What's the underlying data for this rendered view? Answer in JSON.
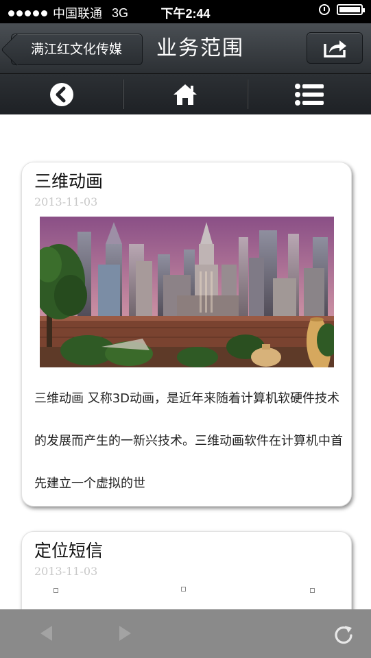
{
  "status_bar": {
    "carrier": "中国联通",
    "network": "3G",
    "time": "下午2:44"
  },
  "header": {
    "back_label": "满江红文化传媒",
    "title": "业务范围"
  },
  "toolbar": {
    "items": [
      "back",
      "home",
      "menu"
    ]
  },
  "articles": [
    {
      "title": "三维动画",
      "date": "2013-11-03",
      "text": "三维动画 又称3D动画，是近年来随着计算机软硬件技术的发展而产生的一新兴技术。三维动画软件在计算机中首先建立一个虚拟的世"
    },
    {
      "title": "定位短信",
      "date": "2013-11-03"
    }
  ]
}
